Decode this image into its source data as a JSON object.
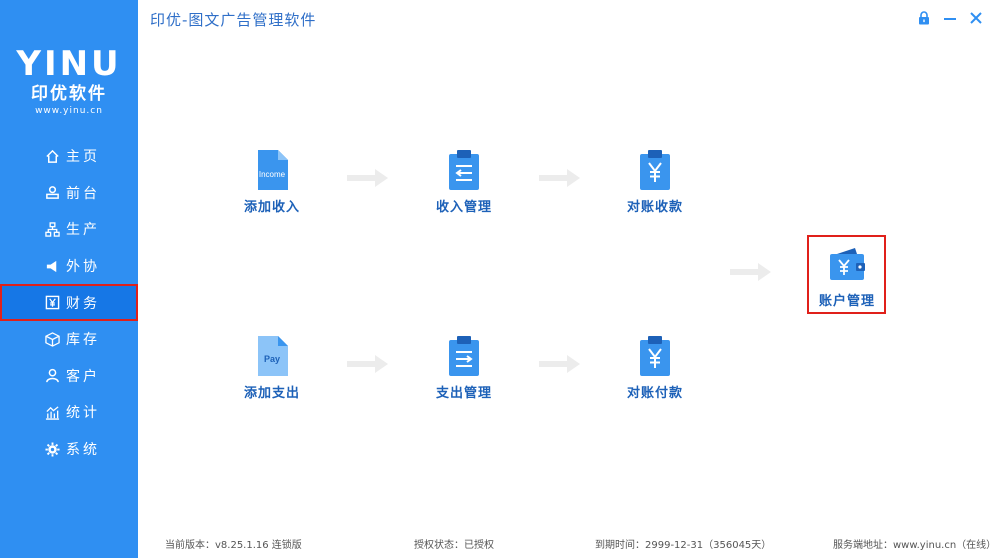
{
  "app": {
    "title": "印优-图文广告管理软件"
  },
  "logo": {
    "mark": "YINU",
    "name": "印优软件",
    "url": "www.yinu.cn"
  },
  "sidebar": {
    "items": [
      {
        "label": "主页",
        "icon": "home-icon"
      },
      {
        "label": "前台",
        "icon": "user-desk-icon"
      },
      {
        "label": "生产",
        "icon": "org-chart-icon"
      },
      {
        "label": "外协",
        "icon": "share-icon"
      },
      {
        "label": "财务",
        "icon": "yen-box-icon",
        "active": true
      },
      {
        "label": "库存",
        "icon": "cube-icon"
      },
      {
        "label": "客户",
        "icon": "person-icon"
      },
      {
        "label": "统计",
        "icon": "chart-icon"
      },
      {
        "label": "系统",
        "icon": "gear-icon"
      }
    ]
  },
  "window_controls": [
    "lock-icon",
    "minimize-icon",
    "close-icon"
  ],
  "flow": {
    "income_row": [
      {
        "label": "添加收入",
        "icon_text": "Income"
      },
      {
        "label": "收入管理"
      },
      {
        "label": "对账收款"
      }
    ],
    "expense_row": [
      {
        "label": "添加支出",
        "icon_text": "Pay"
      },
      {
        "label": "支出管理"
      },
      {
        "label": "对账付款"
      }
    ],
    "account": {
      "label": "账户管理"
    }
  },
  "footer": {
    "version": "当前版本：v8.25.1.16  连锁版",
    "license": "授权状态：已授权",
    "expiry": "到期时间：2999-12-31（356045天）",
    "server": "服务端地址：www.yinu.cn（在线）"
  },
  "colors": {
    "sidebar": "#2f8ff2",
    "active": "#1677e6",
    "highlight": "#e0201a",
    "icon": "#3a95ee",
    "label": "#1d61b8"
  }
}
